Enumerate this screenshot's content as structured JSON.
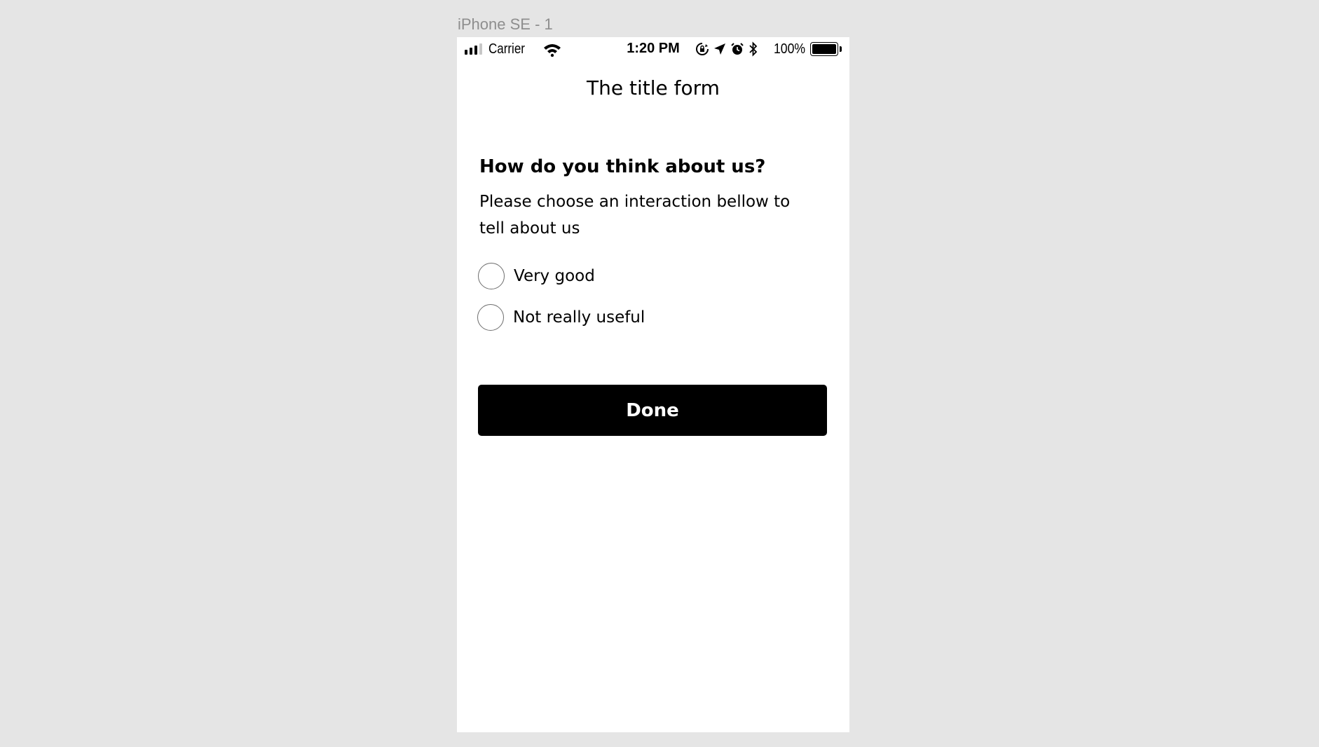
{
  "artboard": {
    "label": "iPhone SE - 1"
  },
  "status_bar": {
    "carrier": "Carrier",
    "time": "1:20 PM",
    "battery_percent": "100%",
    "icons": [
      "signal-icon",
      "wifi-icon",
      "rotation-lock-icon",
      "location-icon",
      "alarm-icon",
      "bluetooth-icon",
      "battery-icon"
    ]
  },
  "nav": {
    "title": "The title form"
  },
  "form": {
    "question": "How do you think about us?",
    "description": "Please choose an interaction bellow to tell about us",
    "options": [
      {
        "label": "Very good",
        "selected": false
      },
      {
        "label": "Not really useful",
        "selected": false
      }
    ],
    "submit_label": "Done"
  },
  "colors": {
    "canvas_background": "#e5e5e5",
    "screen_background": "#ffffff",
    "button_background": "#000000",
    "button_text": "#ffffff",
    "radio_border": "#6e6e6e"
  }
}
